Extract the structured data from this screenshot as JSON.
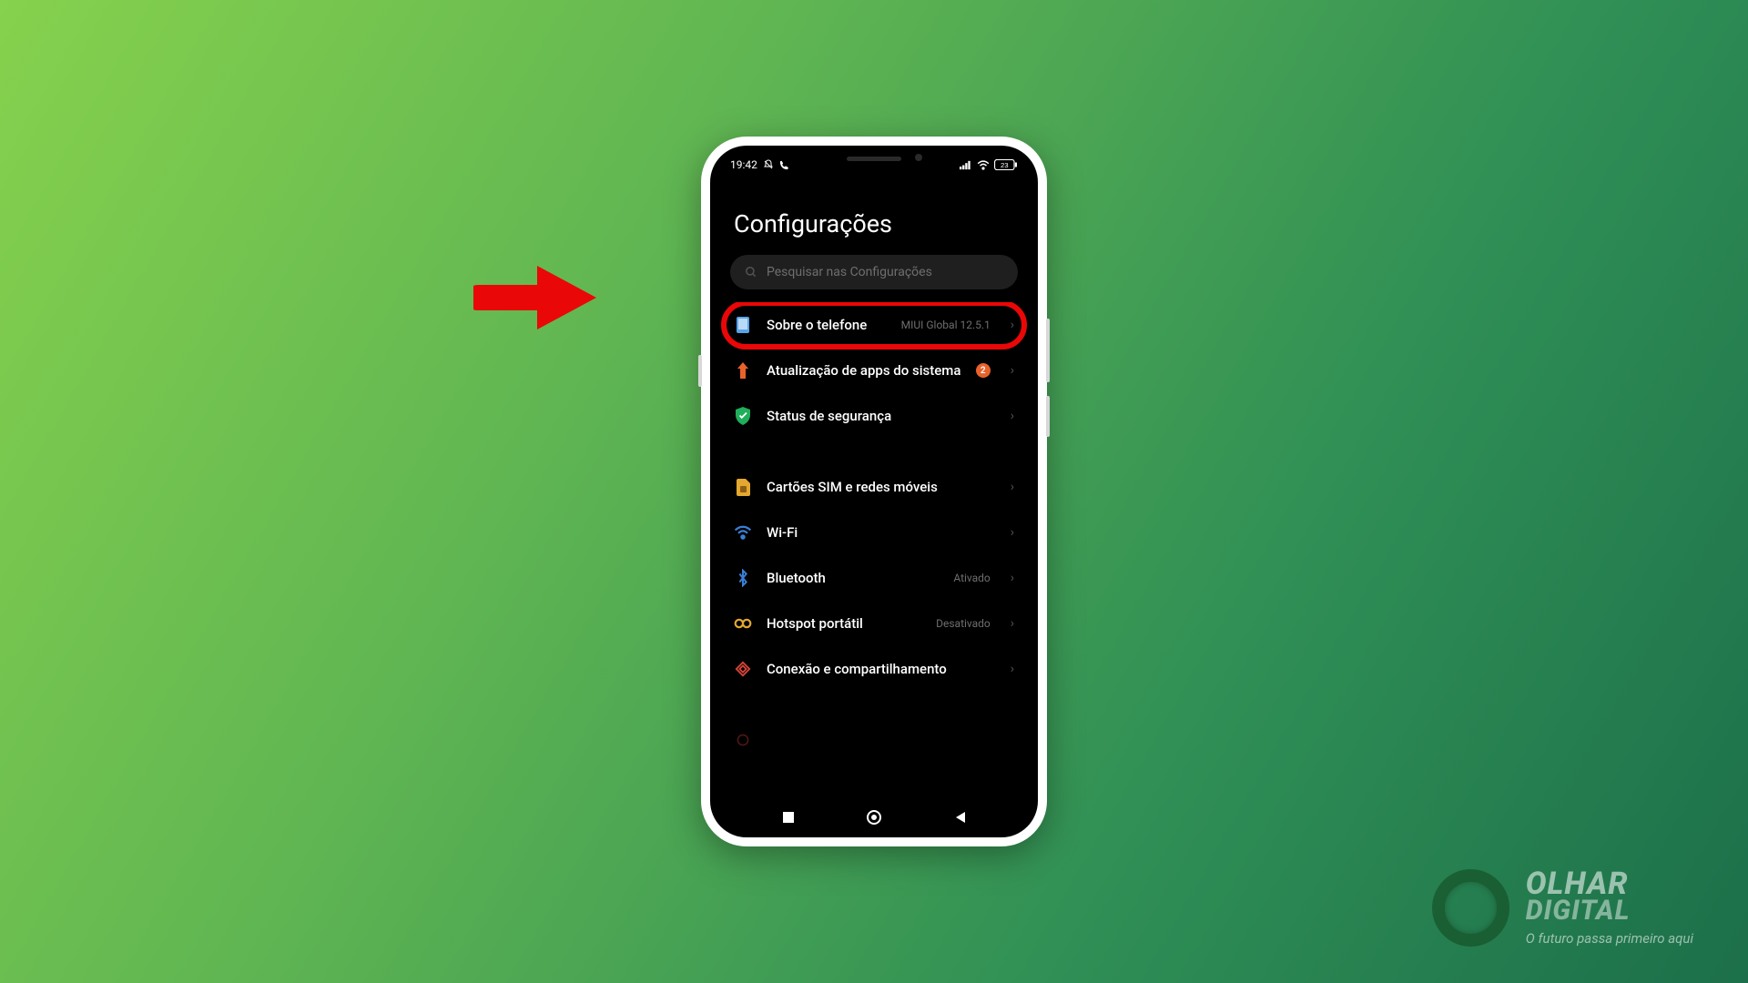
{
  "status": {
    "time": "19:42",
    "battery": "23"
  },
  "title": "Configurações",
  "search": {
    "placeholder": "Pesquisar nas Configurações"
  },
  "rows": [
    {
      "id": "about",
      "label": "Sobre o telefone",
      "sub": "MIUI Global 12.5.1",
      "badge": "",
      "highlight": true
    },
    {
      "id": "apps",
      "label": "Atualização de apps do sistema",
      "sub": "",
      "badge": "2"
    },
    {
      "id": "security",
      "label": "Status de segurança",
      "sub": "",
      "badge": ""
    },
    {
      "id": "divider"
    },
    {
      "id": "sim",
      "label": "Cartões SIM e redes móveis",
      "sub": "",
      "badge": ""
    },
    {
      "id": "wifi",
      "label": "Wi-Fi",
      "sub": "",
      "badge": ""
    },
    {
      "id": "bt",
      "label": "Bluetooth",
      "sub": "Ativado",
      "badge": ""
    },
    {
      "id": "hotspot",
      "label": "Hotspot portátil",
      "sub": "Desativado",
      "badge": ""
    },
    {
      "id": "conn",
      "label": "Conexão e compartilhamento",
      "sub": "",
      "badge": ""
    }
  ],
  "watermark": {
    "l1": "OLHAR",
    "l2": "DIGITAL",
    "tag": "O futuro passa primeiro aqui"
  }
}
